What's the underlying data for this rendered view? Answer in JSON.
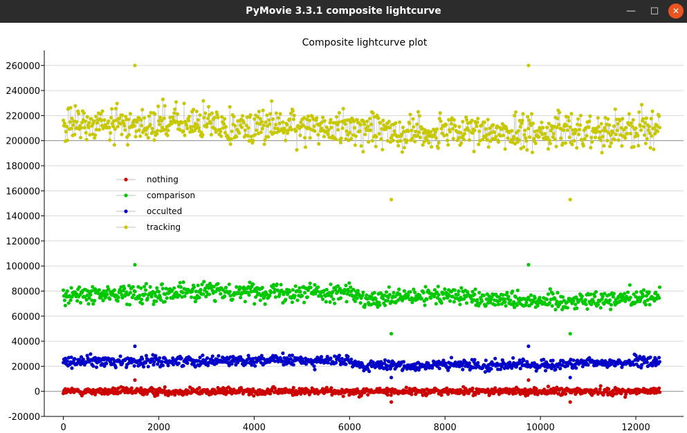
{
  "window": {
    "title": "PyMovie 3.3.1 composite lightcurve",
    "controls": {
      "minimize_icon": "minimize-icon",
      "maximize_icon": "maximize-icon",
      "close_icon": "close-icon"
    }
  },
  "chart_data": {
    "type": "scatter",
    "title": "Composite lightcurve plot",
    "xlabel": "",
    "ylabel": "",
    "xlim": [
      -400,
      13000
    ],
    "ylim": [
      -20000,
      272000
    ],
    "x_ticks": [
      0,
      2000,
      4000,
      6000,
      8000,
      10000,
      12000
    ],
    "x_tick_labels": [
      "0",
      "2000",
      "4000",
      "6000",
      "8000",
      "10000",
      "12000"
    ],
    "y_ticks": [
      -20000,
      0,
      20000,
      40000,
      60000,
      80000,
      100000,
      120000,
      140000,
      160000,
      180000,
      200000,
      220000,
      240000,
      260000
    ],
    "y_tick_labels": [
      "-20000",
      "0",
      "20000",
      "40000",
      "60000",
      "80000",
      "100000",
      "120000",
      "140000",
      "160000",
      "180000",
      "200000",
      "220000",
      "240000",
      "260000"
    ],
    "grid": true,
    "legend_position": "upper-left",
    "x_start": 0,
    "x_end": 12500,
    "series": [
      {
        "name": "nothing",
        "color": "#cc0000",
        "center": 0,
        "spread": 2500,
        "min": -8500,
        "max": 9000,
        "trend_x": [
          0,
          2500,
          5000,
          7500,
          10000,
          12500
        ],
        "trend_y": [
          0,
          0,
          0,
          0,
          0,
          0
        ]
      },
      {
        "name": "comparison",
        "color": "#00c800",
        "center": 77000,
        "spread": 6000,
        "min": 46000,
        "max": 101000,
        "trend_x": [
          0,
          2000,
          4000,
          6000,
          6300,
          8000,
          9000,
          10500,
          12500
        ],
        "trend_y": [
          76000,
          79000,
          80000,
          79000,
          72000,
          77000,
          74000,
          72000,
          76000
        ]
      },
      {
        "name": "occulted",
        "color": "#0000c8",
        "center": 24000,
        "spread": 3500,
        "min": 11000,
        "max": 36000,
        "trend_x": [
          0,
          2000,
          4000,
          6000,
          6300,
          8000,
          10000,
          12500
        ],
        "trend_y": [
          24000,
          24000,
          25000,
          24000,
          20000,
          21000,
          21000,
          24000
        ]
      },
      {
        "name": "tracking",
        "color": "#c8c800",
        "center": 210000,
        "spread": 12000,
        "min": 153000,
        "max": 260000,
        "trend_x": [
          0,
          2000,
          4000,
          6000,
          8000,
          10000,
          12500
        ],
        "trend_y": [
          212000,
          214000,
          212000,
          210000,
          206000,
          207000,
          210000
        ]
      }
    ]
  }
}
